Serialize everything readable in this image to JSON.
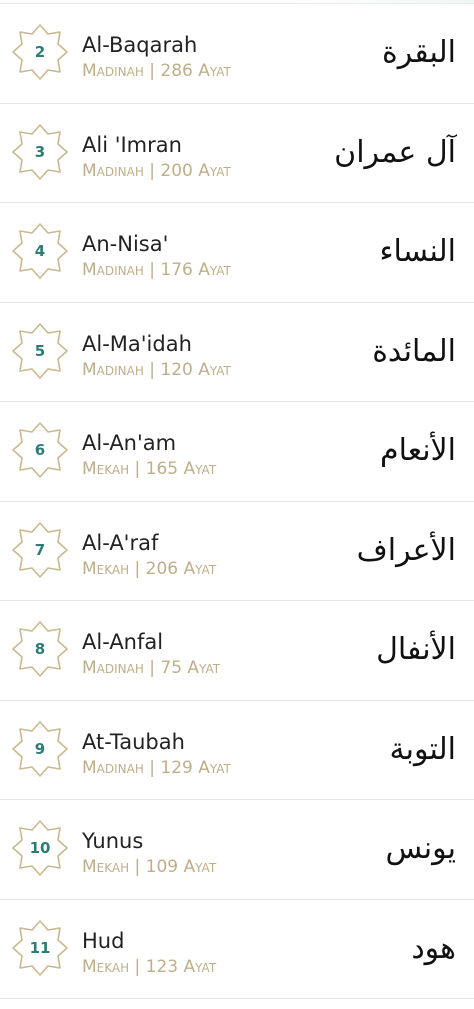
{
  "surahs": [
    {
      "number": "2",
      "name": "Al-Baqarah",
      "meta": "Madinah | 286 Ayat",
      "arabic": "البقرة"
    },
    {
      "number": "3",
      "name": "Ali 'Imran",
      "meta": "Madinah | 200 Ayat",
      "arabic": "آل عمران"
    },
    {
      "number": "4",
      "name": "An-Nisa'",
      "meta": "Madinah | 176 Ayat",
      "arabic": "النساء"
    },
    {
      "number": "5",
      "name": "Al-Ma'idah",
      "meta": "Madinah | 120 Ayat",
      "arabic": "المائدة"
    },
    {
      "number": "6",
      "name": "Al-An'am",
      "meta": "Mekah | 165 Ayat",
      "arabic": "الأنعام"
    },
    {
      "number": "7",
      "name": "Al-A'raf",
      "meta": "Mekah | 206 Ayat",
      "arabic": "الأعراف"
    },
    {
      "number": "8",
      "name": "Al-Anfal",
      "meta": "Madinah | 75 Ayat",
      "arabic": "الأنفال"
    },
    {
      "number": "9",
      "name": "At-Taubah",
      "meta": "Madinah | 129 Ayat",
      "arabic": "التوبة"
    },
    {
      "number": "10",
      "name": "Yunus",
      "meta": "Mekah | 109 Ayat",
      "arabic": "يونس"
    },
    {
      "number": "11",
      "name": "Hud",
      "meta": "Mekah | 123 Ayat",
      "arabic": "هود"
    }
  ],
  "colors": {
    "badge_number": "#2e7d74",
    "badge_outline": "#c9b98f",
    "meta_text": "#bfae8a",
    "name_text": "#222222",
    "divider": "#e6e6e6"
  },
  "icons": {
    "badge": "star-octagon-icon"
  }
}
